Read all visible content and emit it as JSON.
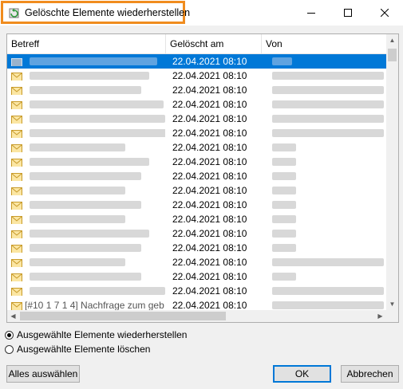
{
  "window": {
    "title": "Gelöschte Elemente wiederherstellen"
  },
  "table": {
    "columns": [
      "Betreff",
      "Gelöscht am",
      "Von"
    ],
    "rows": [
      {
        "date": "22.04.2021 08:10",
        "selected": true
      },
      {
        "date": "22.04.2021 08:10"
      },
      {
        "date": "22.04.2021 08:10"
      },
      {
        "date": "22.04.2021 08:10"
      },
      {
        "date": "22.04.2021 08:10"
      },
      {
        "date": "22.04.2021 08:10"
      },
      {
        "date": "22.04.2021 08:10"
      },
      {
        "date": "22.04.2021 08:10"
      },
      {
        "date": "22.04.2021 08:10"
      },
      {
        "date": "22.04.2021 08:10"
      },
      {
        "date": "22.04.2021 08:10"
      },
      {
        "date": "22.04.2021 08:10"
      },
      {
        "date": "22.04.2021 08:10"
      },
      {
        "date": "22.04.2021 08:10"
      },
      {
        "date": "22.04.2021 08:10"
      },
      {
        "date": "22.04.2021 08:10"
      },
      {
        "date": "22.04.2021 08:10"
      },
      {
        "date": "22.04.2021 08:10",
        "subject": "[#10 1 7 1 4] Nachfrage zum geb"
      }
    ]
  },
  "options": {
    "restore_label": "Ausgewählte Elemente wiederherstellen",
    "delete_label": "Ausgewählte Elemente löschen",
    "selected": "restore"
  },
  "buttons": {
    "select_all": "Alles auswählen",
    "ok": "OK",
    "cancel": "Abbrechen"
  },
  "colors": {
    "accent": "#0078d7",
    "highlight_box": "#f08c1e"
  }
}
